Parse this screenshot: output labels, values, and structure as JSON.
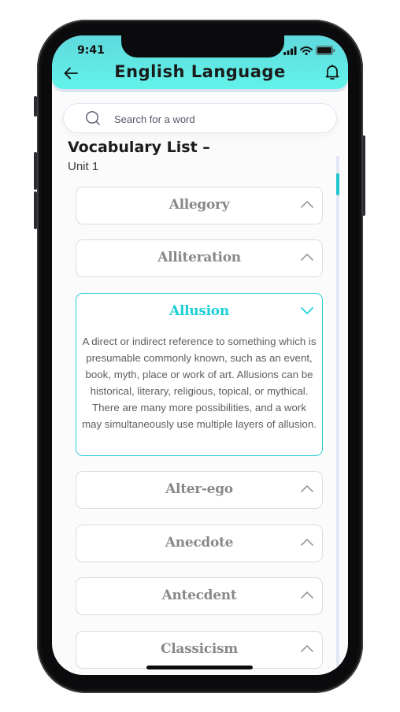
{
  "status_bar": {
    "time": "9:41"
  },
  "header": {
    "title": "English Language",
    "back_icon": "arrow-left-icon",
    "notification_icon": "bell-icon"
  },
  "search": {
    "placeholder": "Search for a word",
    "value": ""
  },
  "list": {
    "title": "Vocabulary List –",
    "subtitle": "Unit 1",
    "items": [
      {
        "label": "Allegory",
        "expanded": false
      },
      {
        "label": "Alliteration",
        "expanded": false
      },
      {
        "label": "Allusion",
        "expanded": true,
        "definition": "A direct or indirect reference to something which is presumable commonly known, such as an event, book, myth, place or work of art. Allusions can be historical, literary, religious, topical, or mythical. There are many more possibilities, and a work may simultaneously use multiple layers of allusion."
      },
      {
        "label": "Alter-ego",
        "expanded": false
      },
      {
        "label": "Anecdote",
        "expanded": false
      },
      {
        "label": "Antecdent",
        "expanded": false
      },
      {
        "label": "Classicism",
        "expanded": false
      }
    ]
  },
  "colors": {
    "accent": "#1ccfd7",
    "header_top": "#5fd9dc",
    "header_bottom": "#62f3ea",
    "item_text": "#888888"
  }
}
